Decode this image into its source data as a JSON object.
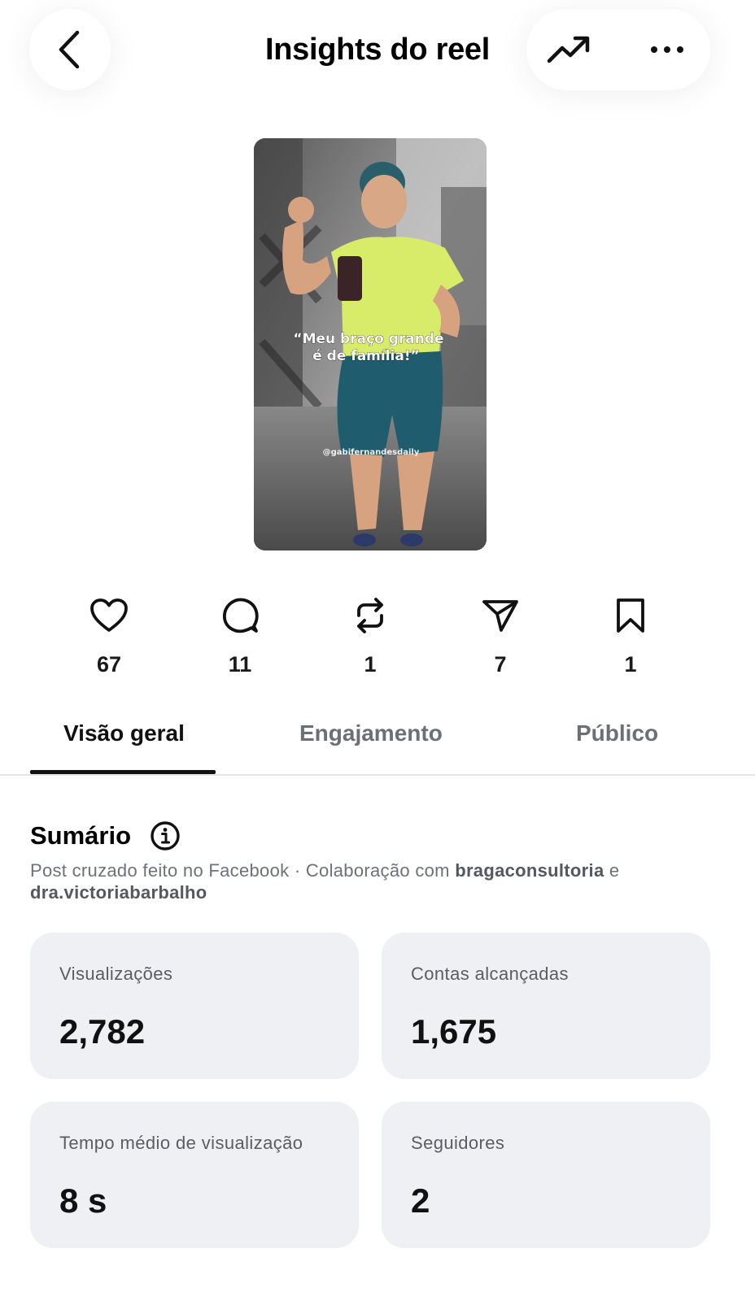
{
  "header": {
    "title": "Insights do reel"
  },
  "icons": {
    "back": "chevron-left-icon",
    "trend": "trending-up-icon",
    "more": "more-horizontal-icon"
  },
  "reel": {
    "caption_line1": "“Meu braço grande",
    "caption_line2": "é de família!”",
    "watermark": "@gabifernandesdaily"
  },
  "stats": [
    {
      "icon": "heart-icon",
      "value": "67"
    },
    {
      "icon": "comment-icon",
      "value": "11"
    },
    {
      "icon": "repost-icon",
      "value": "1"
    },
    {
      "icon": "share-icon",
      "value": "7"
    },
    {
      "icon": "bookmark-icon",
      "value": "1"
    }
  ],
  "tabs": [
    {
      "label": "Visão geral",
      "active": true
    },
    {
      "label": "Engajamento",
      "active": false
    },
    {
      "label": "Público",
      "active": false
    }
  ],
  "summary": {
    "title": "Sumário",
    "desc_prefix": "Post cruzado feito no Facebook · Colaboração com ",
    "collaborator1": "bragaconsultoria",
    "desc_join": " e",
    "collaborator2": "dra.victoriabarbalho"
  },
  "metrics": [
    {
      "label": "Visualizações",
      "value": "2,782"
    },
    {
      "label": "Contas alcançadas",
      "value": "1,675"
    },
    {
      "label": "Tempo médio de visualização",
      "value": "8 s"
    },
    {
      "label": "Seguidores",
      "value": "2"
    }
  ],
  "colors": {
    "card_bg": "#eff0f3",
    "muted_text": "#6e7177",
    "shirt": "#d9ec6a",
    "shorts": "#1f5c6e"
  }
}
